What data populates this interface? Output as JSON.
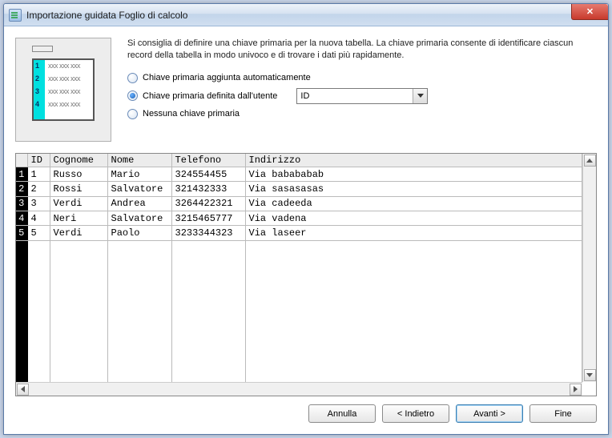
{
  "window": {
    "title": "Importazione guidata Foglio di calcolo"
  },
  "intro": "Si consiglia di definire una chiave primaria per la nuova tabella. La chiave primaria consente di identificare ciascun record della tabella in modo univoco e di trovare i dati più rapidamente.",
  "options": {
    "auto": "Chiave primaria aggiunta automaticamente",
    "user": "Chiave primaria definita dall'utente",
    "none": "Nessuna chiave primaria",
    "selected": "user",
    "field": "ID"
  },
  "columns": [
    "",
    "ID",
    "Cognome",
    "Nome",
    "Telefono",
    "Indirizzo"
  ],
  "rows": [
    {
      "n": "1",
      "id": "1",
      "cognome": "Russo",
      "nome": "Mario",
      "telefono": "324554455",
      "indirizzo": "Via babababab"
    },
    {
      "n": "2",
      "id": "2",
      "cognome": "Rossi",
      "nome": "Salvatore",
      "telefono": "321432333",
      "indirizzo": "Via sasasasas"
    },
    {
      "n": "3",
      "id": "3",
      "cognome": "Verdi",
      "nome": "Andrea",
      "telefono": "3264422321",
      "indirizzo": "Via cadeeda"
    },
    {
      "n": "4",
      "id": "4",
      "cognome": "Neri",
      "nome": "Salvatore",
      "telefono": "3215465777",
      "indirizzo": "Via vadena"
    },
    {
      "n": "5",
      "id": "5",
      "cognome": "Verdi",
      "nome": "Paolo",
      "telefono": "3233344323",
      "indirizzo": "Via laseer"
    }
  ],
  "buttons": {
    "cancel": "Annulla",
    "back": "< Indietro",
    "next": "Avanti >",
    "finish": "Fine"
  },
  "thumb_rows": [
    "1",
    "2",
    "3",
    "4"
  ]
}
